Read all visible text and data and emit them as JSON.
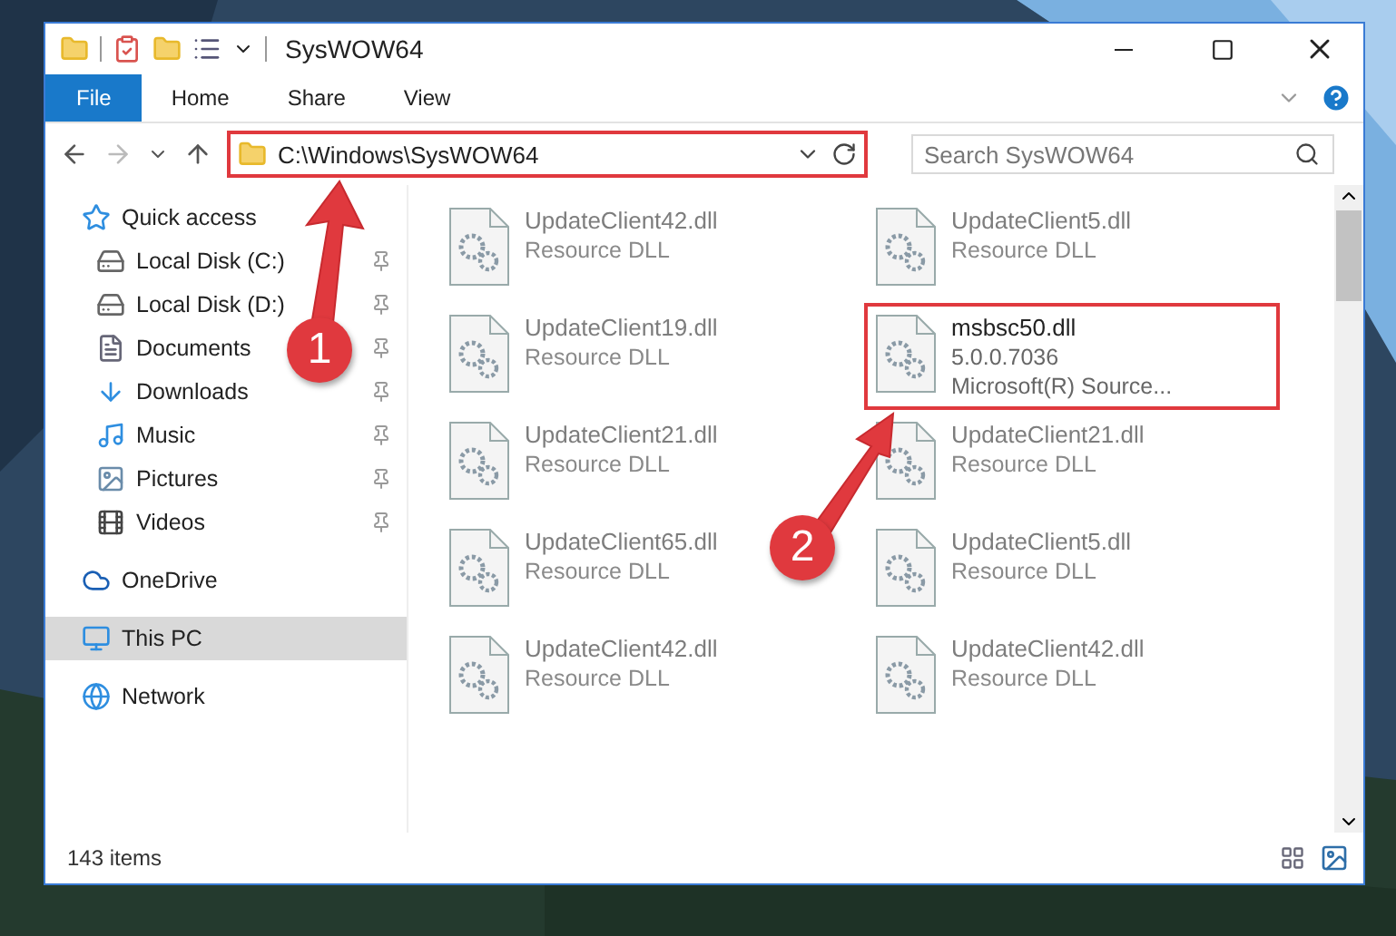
{
  "window": {
    "title": "SysWOW64"
  },
  "ribbon_tabs": [
    {
      "label": "File",
      "selected": true
    },
    {
      "label": "Home",
      "selected": false
    },
    {
      "label": "Share",
      "selected": false
    },
    {
      "label": "View",
      "selected": false
    }
  ],
  "address": {
    "path": "C:\\Windows\\SysWOW64",
    "highlighted": true
  },
  "search": {
    "placeholder": "Search SysWOW64"
  },
  "nav": [
    {
      "label": "Quick access",
      "kind": "star",
      "selected": false,
      "children": [
        {
          "label": "Local Disk (C:)",
          "kind": "drive",
          "pinned": true,
          "selected": false
        },
        {
          "label": "Local Disk (D:)",
          "kind": "drive",
          "pinned": true,
          "selected": false
        },
        {
          "label": "Documents",
          "kind": "document",
          "pinned": true,
          "selected": false
        },
        {
          "label": "Downloads",
          "kind": "download",
          "pinned": true,
          "selected": false
        },
        {
          "label": "Music",
          "kind": "music",
          "pinned": true,
          "selected": false
        },
        {
          "label": "Pictures",
          "kind": "pictures",
          "pinned": true,
          "selected": false
        },
        {
          "label": "Videos",
          "kind": "video",
          "pinned": true,
          "selected": false
        }
      ]
    },
    {
      "label": "OneDrive",
      "kind": "cloud",
      "selected": false
    },
    {
      "label": "This PC",
      "kind": "pc",
      "selected": true
    },
    {
      "label": "Network",
      "kind": "network",
      "selected": false
    }
  ],
  "files": [
    {
      "name": "UpdateClient42.dll",
      "details": [
        "Resource DLL"
      ],
      "faded": true,
      "highlighted": false
    },
    {
      "name": "UpdateClient5.dll",
      "details": [
        "Resource DLL"
      ],
      "faded": true,
      "highlighted": false
    },
    {
      "name": "UpdateClient19.dll",
      "details": [
        "Resource DLL"
      ],
      "faded": true,
      "highlighted": false
    },
    {
      "name": "msbsc50.dll",
      "details": [
        "5.0.0.7036",
        "Microsoft(R) Source..."
      ],
      "faded": false,
      "highlighted": true
    },
    {
      "name": "UpdateClient21.dll",
      "details": [
        "Resource DLL"
      ],
      "faded": true,
      "highlighted": false
    },
    {
      "name": "UpdateClient21.dll",
      "details": [
        "Resource DLL"
      ],
      "faded": true,
      "highlighted": false
    },
    {
      "name": "UpdateClient65.dll",
      "details": [
        "Resource DLL"
      ],
      "faded": true,
      "highlighted": false
    },
    {
      "name": "UpdateClient5.dll",
      "details": [
        "Resource DLL"
      ],
      "faded": true,
      "highlighted": false
    },
    {
      "name": "UpdateClient42.dll",
      "details": [
        "Resource DLL"
      ],
      "faded": true,
      "highlighted": false
    },
    {
      "name": "UpdateClient42.dll",
      "details": [
        "Resource DLL"
      ],
      "faded": true,
      "highlighted": false
    }
  ],
  "status_bar": {
    "item_count": "143 items"
  },
  "annotations": [
    {
      "label": "1"
    },
    {
      "label": "2"
    }
  ]
}
